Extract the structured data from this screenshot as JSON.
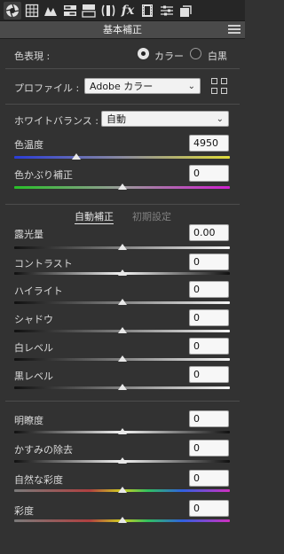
{
  "toolbar": {
    "tools": [
      {
        "icon": "camera-aperture-icon",
        "active": true
      },
      {
        "icon": "curve-grid-icon"
      },
      {
        "icon": "mountain-icon"
      },
      {
        "icon": "hsl-panel-icon"
      },
      {
        "icon": "split-toning-icon"
      },
      {
        "icon": "lens-correction-icon"
      },
      {
        "icon": "fx-effects-icon",
        "glyph": "fx"
      },
      {
        "icon": "film-strip-icon"
      },
      {
        "icon": "sliders-icon"
      },
      {
        "icon": "presets-icon"
      }
    ]
  },
  "panel": {
    "title": "基本補正"
  },
  "color_treatment": {
    "label": "色表現 :",
    "options": [
      {
        "label": "カラー",
        "selected": true
      },
      {
        "label": "白黒",
        "selected": false
      }
    ]
  },
  "profile": {
    "label": "プロファイル :",
    "value": "Adobe カラー"
  },
  "white_balance": {
    "label": "ホワイトバランス :",
    "value": "自動"
  },
  "tabs": {
    "auto": "自動補正",
    "default": "初期設定"
  },
  "sliders": {
    "temperature": {
      "label": "色温度",
      "value": "4950",
      "position": 0.29
    },
    "tint": {
      "label": "色かぶり補正",
      "value": "0",
      "position": 0.5
    },
    "exposure": {
      "label": "露光量",
      "value": "0.00",
      "position": 0.5
    },
    "contrast": {
      "label": "コントラスト",
      "value": "0",
      "position": 0.5
    },
    "highlights": {
      "label": "ハイライト",
      "value": "0",
      "position": 0.5
    },
    "shadows": {
      "label": "シャドウ",
      "value": "0",
      "position": 0.5
    },
    "whites": {
      "label": "白レベル",
      "value": "0",
      "position": 0.5
    },
    "blacks": {
      "label": "黒レベル",
      "value": "0",
      "position": 0.5
    },
    "clarity": {
      "label": "明瞭度",
      "value": "0",
      "position": 0.5
    },
    "dehaze": {
      "label": "かすみの除去",
      "value": "0",
      "position": 0.5
    },
    "vibrance": {
      "label": "自然な彩度",
      "value": "0",
      "position": 0.5
    },
    "saturation": {
      "label": "彩度",
      "value": "0",
      "position": 0.5
    }
  },
  "colors": {
    "background": "#323232",
    "toolbar": "#262626",
    "header": "#4a4a4a"
  }
}
